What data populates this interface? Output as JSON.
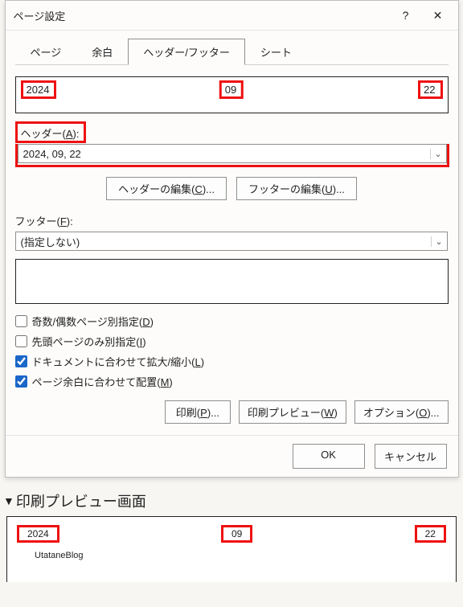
{
  "titlebar": {
    "title": "ページ設定",
    "help": "?",
    "close": "✕"
  },
  "tabs": {
    "page": "ページ",
    "margin": "余白",
    "headerfooter": "ヘッダー/フッター",
    "sheet": "シート"
  },
  "headerPreview": {
    "left": "2024",
    "center": "09",
    "right": "22"
  },
  "headerSection": {
    "label_pre": "ヘッダー(",
    "label_key": "A",
    "label_post": "):",
    "value": "2024, 09, 22"
  },
  "editButtons": {
    "header_pre": "ヘッダーの編集(",
    "header_key": "C",
    "header_post": ")...",
    "footer_pre": "フッターの編集(",
    "footer_key": "U",
    "footer_post": ")..."
  },
  "footerSection": {
    "label_pre": "フッター(",
    "label_key": "F",
    "label_post": "):",
    "value": "(指定しない)"
  },
  "checks": {
    "oddEven_pre": "奇数/偶数ページ別指定(",
    "oddEven_key": "D",
    "oddEven_post": ")",
    "firstOnly_pre": "先頭ページのみ別指定(",
    "firstOnly_key": "I",
    "firstOnly_post": ")",
    "scaleDoc_pre": "ドキュメントに合わせて拡大/縮小(",
    "scaleDoc_key": "L",
    "scaleDoc_post": ")",
    "alignMargin_pre": "ページ余白に合わせて配置(",
    "alignMargin_key": "M",
    "alignMargin_post": ")"
  },
  "actions": {
    "print_pre": "印刷(",
    "print_key": "P",
    "print_post": ")...",
    "preview_pre": "印刷プレビュー(",
    "preview_key": "W",
    "preview_post": ")",
    "options_pre": "オプション(",
    "options_key": "O",
    "options_post": ")..."
  },
  "dialogButtons": {
    "ok": "OK",
    "cancel": "キャンセル"
  },
  "lower": {
    "caption": "印刷プレビュー画面",
    "left": "2024",
    "center": "09",
    "right": "22",
    "subtext": "UtataneBlog"
  }
}
